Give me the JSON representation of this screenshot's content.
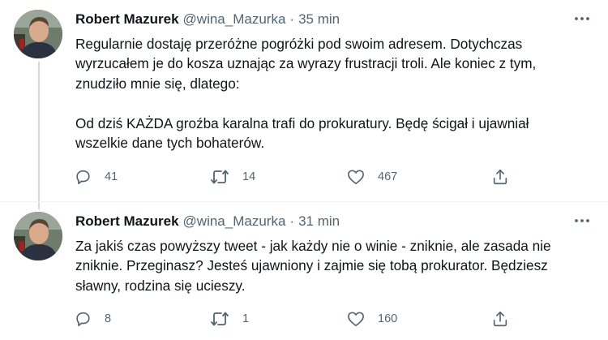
{
  "tweets": [
    {
      "author_name": "Robert Mazurek",
      "handle": "@wina_Mazurka",
      "separator": "·",
      "time": "35 min",
      "paragraphs": [
        "Regularnie dostaję przeróżne pogróżki pod swoim adresem. Dotychczas",
        "wyrzucałem je do kosza uznając za wyrazy frustracji troli. Ale koniec z tym,",
        "znudziło mnie się, dlatego:",
        "",
        "Od dziś KAŻDA groźba karalna trafi do prokuratury. Będę ścigał i ujawniał",
        "wszelkie dane tych bohaterów."
      ],
      "replies": "41",
      "retweets": "14",
      "likes": "467"
    },
    {
      "author_name": "Robert Mazurek",
      "handle": "@wina_Mazurka",
      "separator": "·",
      "time": "31 min",
      "paragraphs": [
        "Za jakiś czas powyższy tweet - jak każdy nie o winie - zniknie, ale zasada nie",
        "zniknie. Przeginasz? Jesteś ujawniony i zajmie się tobą prokurator. Będziesz",
        "sławny, rodzina się ucieszy."
      ],
      "replies": "8",
      "retweets": "1",
      "likes": "160"
    }
  ],
  "icons": {
    "more": "more-dots-icon",
    "reply": "reply-bubble-icon",
    "retweet": "retweet-icon",
    "like": "heart-icon",
    "share": "share-icon"
  },
  "colors": {
    "text_primary": "#0f1419",
    "text_secondary": "#536471",
    "thread_line": "#cfd9de"
  }
}
